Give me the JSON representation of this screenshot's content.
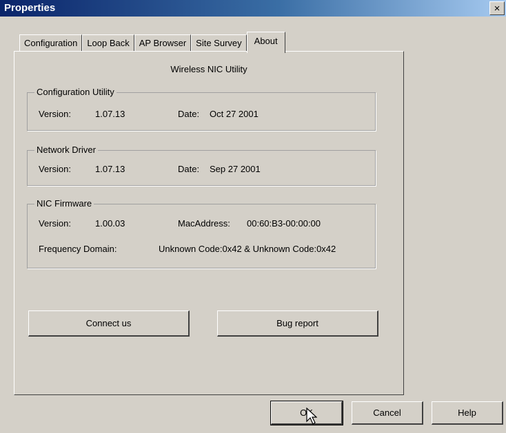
{
  "window": {
    "title": "Properties",
    "close_label": "×"
  },
  "tabs": [
    {
      "label": "Configuration",
      "active": false
    },
    {
      "label": "Loop Back",
      "active": false
    },
    {
      "label": "AP Browser",
      "active": false
    },
    {
      "label": "Site Survey",
      "active": false
    },
    {
      "label": "About",
      "active": true
    }
  ],
  "about": {
    "heading": "Wireless NIC Utility",
    "config_utility": {
      "legend": "Configuration Utility",
      "version_label": "Version:",
      "version": "1.07.13",
      "date_label": "Date:",
      "date": "Oct 27 2001"
    },
    "network_driver": {
      "legend": "Network Driver",
      "version_label": "Version:",
      "version": "1.07.13",
      "date_label": "Date:",
      "date": "Sep 27 2001"
    },
    "nic_firmware": {
      "legend": "NIC Firmware",
      "version_label": "Version:",
      "version": "1.00.03",
      "mac_label": "MacAddress:",
      "mac": "00:60:B3-00:00:00",
      "freq_label": "Frequency Domain:",
      "freq": "Unknown Code:0x42 & Unknown Code:0x42"
    },
    "connect_button": "Connect us",
    "bug_button": "Bug report"
  },
  "footer": {
    "ok": "OK",
    "cancel": "Cancel",
    "help": "Help"
  }
}
